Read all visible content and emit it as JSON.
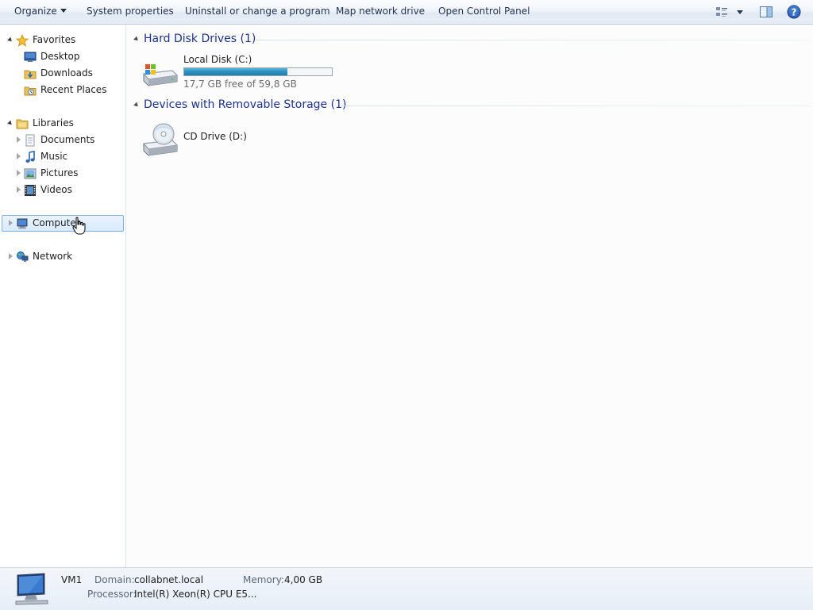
{
  "toolbar": {
    "organize": "Organize",
    "system_properties": "System properties",
    "uninstall": "Uninstall or change a program",
    "map_network": "Map network drive",
    "control_panel": "Open Control Panel",
    "icons": [
      "views-icon",
      "preview-pane-icon",
      "help-icon"
    ]
  },
  "nav": {
    "favorites": {
      "label": "Favorites",
      "items": [
        "Desktop",
        "Downloads",
        "Recent Places"
      ]
    },
    "libraries": {
      "label": "Libraries",
      "items": [
        "Documents",
        "Music",
        "Pictures",
        "Videos"
      ]
    },
    "computer": "Computer",
    "network": "Network",
    "selected": "Computer"
  },
  "groups": {
    "hard_disks": {
      "header": "Hard Disk Drives (1)",
      "drives": [
        {
          "name": "Local Disk (C:)",
          "free_text": "17,7 GB free of 59,8 GB",
          "used_fraction": 0.7
        }
      ]
    },
    "removable": {
      "header": "Devices with Removable Storage (1)",
      "drives": [
        {
          "name": "CD Drive (D:)"
        }
      ]
    }
  },
  "details": {
    "name": "VM1",
    "domain_label": "Domain:",
    "domain_value": "collabnet.local",
    "memory_label": "Memory:",
    "memory_value": "4,00 GB",
    "processor_label": "Processor:",
    "processor_value": "Intel(R) Xeon(R) CPU E5..."
  },
  "colors": {
    "accent": "#1e3287",
    "selection_border": "#84acdd",
    "bar_fill": "#2a8fbf"
  }
}
